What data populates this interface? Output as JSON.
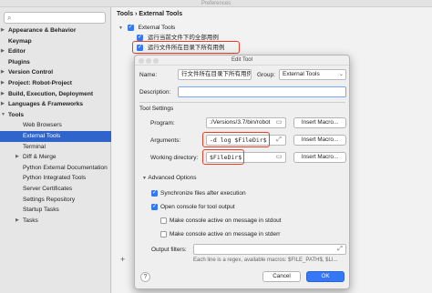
{
  "window": {
    "title": "Preferences"
  },
  "sidebar": {
    "search_placeholder": "",
    "items": [
      {
        "label": "Appearance & Behavior",
        "bold": true,
        "arrow": "▶",
        "indent": 0
      },
      {
        "label": "Keymap",
        "bold": true,
        "arrow": "",
        "indent": 0
      },
      {
        "label": "Editor",
        "bold": true,
        "arrow": "▶",
        "indent": 0
      },
      {
        "label": "Plugins",
        "bold": true,
        "arrow": "",
        "indent": 0
      },
      {
        "label": "Version Control",
        "bold": true,
        "arrow": "▶",
        "indent": 0
      },
      {
        "label": "Project: Robot-Project",
        "bold": true,
        "arrow": "▶",
        "indent": 0
      },
      {
        "label": "Build, Execution, Deployment",
        "bold": true,
        "arrow": "▶",
        "indent": 0
      },
      {
        "label": "Languages & Frameworks",
        "bold": true,
        "arrow": "▶",
        "indent": 0
      },
      {
        "label": "Tools",
        "bold": true,
        "arrow": "▼",
        "indent": 0
      },
      {
        "label": "Web Browsers",
        "bold": false,
        "arrow": "",
        "indent": 1
      },
      {
        "label": "External Tools",
        "bold": false,
        "arrow": "",
        "indent": 1,
        "selected": true
      },
      {
        "label": "Terminal",
        "bold": false,
        "arrow": "",
        "indent": 1
      },
      {
        "label": "Diff & Merge",
        "bold": false,
        "arrow": "▶",
        "indent": 1
      },
      {
        "label": "Python External Documentation",
        "bold": false,
        "arrow": "",
        "indent": 1
      },
      {
        "label": "Python Integrated Tools",
        "bold": false,
        "arrow": "",
        "indent": 1
      },
      {
        "label": "Server Certificates",
        "bold": false,
        "arrow": "",
        "indent": 1
      },
      {
        "label": "Settings Repository",
        "bold": false,
        "arrow": "",
        "indent": 1
      },
      {
        "label": "Startup Tasks",
        "bold": false,
        "arrow": "",
        "indent": 1
      },
      {
        "label": "Tasks",
        "bold": false,
        "arrow": "▶",
        "indent": 1
      }
    ]
  },
  "main": {
    "breadcrumb_root": "Tools",
    "breadcrumb_sep": "›",
    "breadcrumb_leaf": "External Tools",
    "group_label": "External Tools",
    "tools": [
      "运行当前文件下的全部用例",
      "运行文件所在目录下所有用例"
    ],
    "add_glyph": "+"
  },
  "dialog": {
    "title": "Edit Tool",
    "name_label": "Name:",
    "name_value": "行文件所在目录下所有用例",
    "group_label": "Group:",
    "group_value": "External Tools",
    "description_label": "Description:",
    "description_value": "",
    "tool_settings_label": "Tool Settings",
    "program_label": "Program:",
    "program_value": ":/Versions/3.7/bin/robot",
    "arguments_label": "Arguments:",
    "arguments_value": "-d log $FileDir$",
    "working_dir_label": "Working directory:",
    "working_dir_value": "$FileDir$",
    "insert_macro_label": "Insert Macro...",
    "advanced_label": "Advanced Options",
    "opt_sync": "Synchronize files after execution",
    "opt_console": "Open console for tool output",
    "opt_stdout": "Make console active on message in stdout",
    "opt_stderr": "Make console active on message in stderr",
    "output_filters_label": "Output filters:",
    "output_filters_value": "",
    "hint": "Each line is a regex, available macros: $FILE_PATH$, $LI...",
    "cancel_label": "Cancel",
    "ok_label": "OK",
    "help_glyph": "?"
  },
  "colors": {
    "accent": "#3478f6",
    "highlight": "#e8402a",
    "selection": "#2f65ca"
  }
}
